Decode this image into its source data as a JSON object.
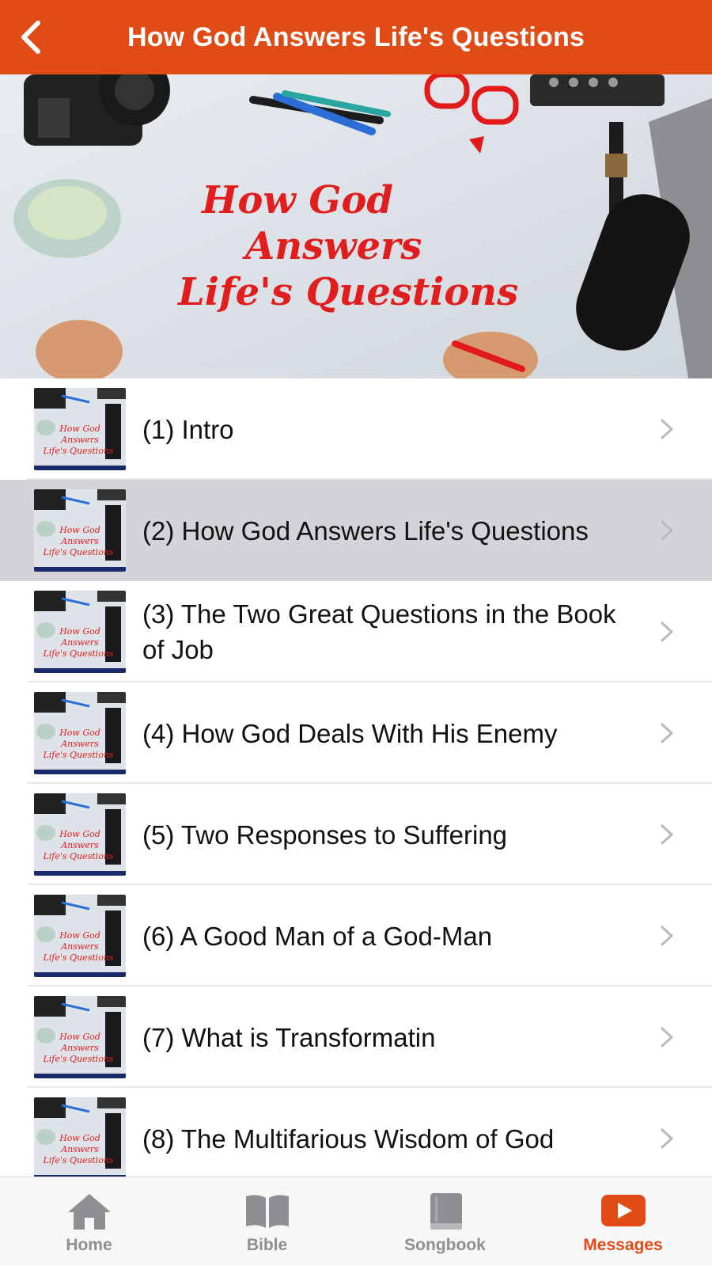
{
  "header": {
    "title": "How God Answers Life's Questions",
    "back_icon": "chevron-left-icon",
    "color": "#e04b16"
  },
  "banner": {
    "lines": [
      "How God",
      "Answers",
      "Life's Questions"
    ]
  },
  "messages": [
    {
      "label": "(1) Intro",
      "selected": false
    },
    {
      "label": "(2) How God Answers Life's Questions",
      "selected": true
    },
    {
      "label": "(3) The Two Great Questions in the Book of Job",
      "selected": false
    },
    {
      "label": "(4) How God Deals With His Enemy",
      "selected": false
    },
    {
      "label": "(5) Two Responses to Suffering",
      "selected": false
    },
    {
      "label": "(6) A Good Man of a God-Man",
      "selected": false
    },
    {
      "label": "(7) What is Transformatin",
      "selected": false
    },
    {
      "label": "(8) The Multifarious Wisdom of God",
      "selected": false
    }
  ],
  "tabs": [
    {
      "label": "Home",
      "icon": "home-icon",
      "active": false
    },
    {
      "label": "Bible",
      "icon": "book-open-icon",
      "active": false
    },
    {
      "label": "Songbook",
      "icon": "songbook-icon",
      "active": false
    },
    {
      "label": "Messages",
      "icon": "video-play-icon",
      "active": true
    }
  ],
  "colors": {
    "accent": "#e04b16",
    "inactive_tab": "#8e8e93",
    "selected_row": "#d3d3d8"
  }
}
